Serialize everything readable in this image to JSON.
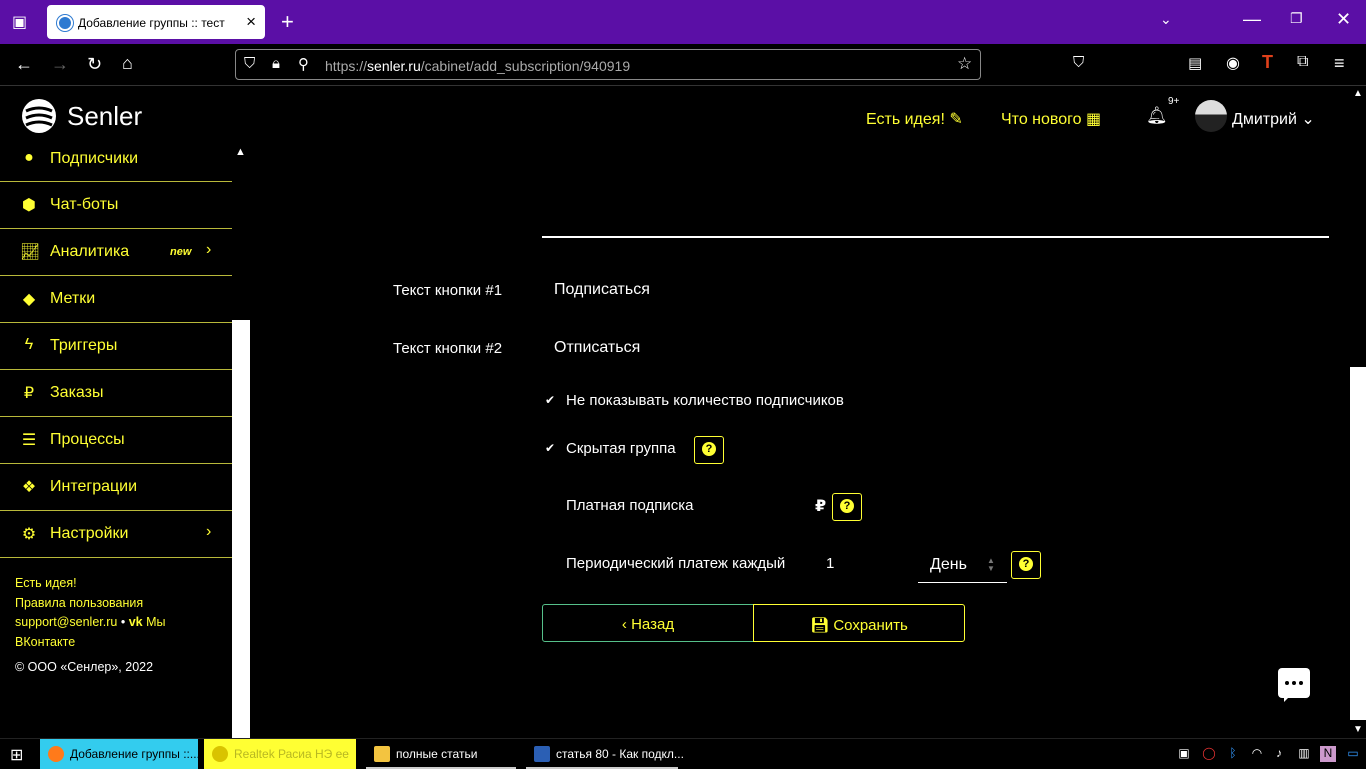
{
  "browser": {
    "tab_title": "Добавление группы :: тест",
    "url_host": "senler.ru",
    "url_prefix": "https://",
    "url_path": "/cabinet/add_subscription/940919"
  },
  "header": {
    "logo_text": "Senler",
    "idea_link": "Есть идея!",
    "news_link": "Что нового",
    "notif_count": "9+",
    "user_name": "Дмитрий"
  },
  "sidebar": {
    "items": [
      {
        "label": "Подписчики",
        "icon": "user-icon"
      },
      {
        "label": "Чат-боты",
        "icon": "android-icon"
      },
      {
        "label": "Аналитика",
        "icon": "chart-icon",
        "badge": "new"
      },
      {
        "label": "Метки",
        "icon": "tag-icon"
      },
      {
        "label": "Триггеры",
        "icon": "bolt-icon"
      },
      {
        "label": "Заказы",
        "icon": "ruble-icon"
      },
      {
        "label": "Процессы",
        "icon": "tasks-icon"
      },
      {
        "label": "Интеграции",
        "icon": "cubes-icon"
      },
      {
        "label": "Настройки",
        "icon": "cogs-icon"
      }
    ],
    "footer": {
      "idea": "Есть идея!",
      "rules": "Правила пользования",
      "email": "support@senler.ru",
      "separator": "•",
      "vk_prefix": "Мы",
      "vk_suffix": "ВКонтакте",
      "copyright": "© ООО «Сенлер», 2022"
    }
  },
  "form": {
    "button1_label": "Текст кнопки #1",
    "button1_value": "Подписаться",
    "button2_label": "Текст кнопки #2",
    "button2_value": "Отписаться",
    "hide_count_label": "Не показывать количество подписчиков",
    "hidden_group_label": "Скрытая группа",
    "paid_label": "Платная подписка",
    "paid_currency": "₽",
    "periodic_label": "Периодический платеж каждый",
    "periodic_value": "1",
    "periodic_unit": "День",
    "back_button": "Назад",
    "save_button": "Сохранить"
  },
  "taskbar": {
    "tasks": [
      {
        "label": "Добавление группы ::..."
      },
      {
        "label": "Realtek Расиа НЭ ее"
      },
      {
        "label": "полные статьи"
      },
      {
        "label": "статья 80 - Как подкл..."
      }
    ]
  },
  "colors": {
    "accent": "#ffff33",
    "tab_strip": "#5b0fa6",
    "back_border": "#56c08a"
  }
}
